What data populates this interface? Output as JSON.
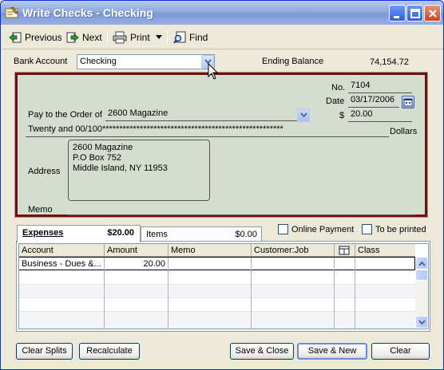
{
  "window": {
    "title": "Write Checks - Checking"
  },
  "toolbar": {
    "previous_label": "Previous",
    "next_label": "Next",
    "print_label": "Print",
    "find_label": "Find"
  },
  "bank": {
    "account_label": "Bank Account",
    "account_value": "Checking",
    "ending_balance_label": "Ending Balance",
    "ending_balance_value": "74,154.72"
  },
  "check": {
    "no_label": "No.",
    "no_value": "7104",
    "date_label": "Date",
    "date_value": "03/17/2006",
    "pay_to_label": "Pay to the Order of",
    "pay_to_value": "2600 Magazine",
    "amount_symbol": "$",
    "amount_value": "20.00",
    "written_amount": "Twenty and 00/100*****************************************************",
    "dollars_label": "Dollars",
    "address_label": "Address",
    "address_lines": [
      "2600 Magazine",
      "P.O Box 752",
      "Middle Island, NY  11953"
    ],
    "memo_label": "Memo",
    "memo_value": ""
  },
  "tabs": [
    {
      "label": "Expenses",
      "amount": "$20.00",
      "active": true
    },
    {
      "label": "Items",
      "amount": "$0.00",
      "active": false
    }
  ],
  "options": {
    "online_payment_label": "Online Payment",
    "online_payment_checked": false,
    "to_be_printed_label": "To be printed",
    "to_be_printed_checked": false
  },
  "grid": {
    "columns": [
      "Account",
      "Amount",
      "Memo",
      "Customer:Job",
      "",
      "Class"
    ],
    "rows": [
      [
        "Business - Dues &...",
        "20.00",
        "",
        "",
        "",
        ""
      ]
    ]
  },
  "buttons": {
    "clear_splits": "Clear Splits",
    "recalculate": "Recalculate",
    "save_close": "Save & Close",
    "save_new": "Save & New",
    "clear": "Clear"
  },
  "colors": {
    "check_bg": "#d5ddd0",
    "check_border": "#6d1111",
    "titlebar": "#7b98d6"
  }
}
